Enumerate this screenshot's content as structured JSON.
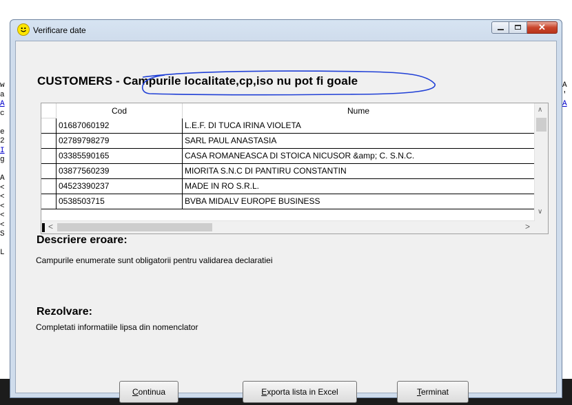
{
  "background": {
    "left_chars": [
      "w",
      "a",
      "A",
      "c",
      "",
      "e",
      "2",
      "I",
      "g",
      "",
      "A",
      "<",
      "<",
      "<",
      "<",
      "<",
      "S",
      "",
      "L"
    ],
    "right_chars": [
      "A",
      "'",
      "A"
    ]
  },
  "window": {
    "title": "Verificare date",
    "close_glyph": "✕"
  },
  "heading": {
    "prefix": "CUSTOMERS - ",
    "message": "Campurile localitate,cp,iso nu pot fi goale"
  },
  "grid": {
    "columns": [
      "Cod",
      "Nume"
    ],
    "rows": [
      {
        "cod": "01687060192",
        "nume": "L.E.F. DI TUCA IRINA VIOLETA"
      },
      {
        "cod": "02789798279",
        "nume": "SARL PAUL ANASTASIA"
      },
      {
        "cod": "03385590165",
        "nume": "CASA ROMANEASCA DI STOICA NICUSOR &amp; C. S.N.C."
      },
      {
        "cod": "03877560239",
        "nume": "MIORITA S.N.C DI PANTIRU CONSTANTIN"
      },
      {
        "cod": "04523390237",
        "nume": "MADE IN RO S.R.L."
      },
      {
        "cod": "0538503715",
        "nume": "BVBA MIDALV EUROPE BUSINESS"
      }
    ],
    "scroll_up": "∧",
    "scroll_down": "∨",
    "scroll_left": "<",
    "scroll_right": ">"
  },
  "error": {
    "title": "Descriere eroare:",
    "text": "Campurile enumerate sunt obligatorii pentru validarea declaratiei"
  },
  "resolution": {
    "title": "Rezolvare:",
    "text": "Completati informatiile lipsa din nomenclator"
  },
  "buttons": {
    "continua": {
      "mnemonic": "C",
      "rest": "ontinua"
    },
    "export": {
      "mnemonic": "E",
      "rest": "xporta lista in Excel"
    },
    "terminat": {
      "mnemonic": "T",
      "rest": "erminat"
    }
  },
  "colors": {
    "scribble": "#1f3fd6",
    "title_bar": "#cfdcec",
    "close_button": "#c9462c"
  }
}
